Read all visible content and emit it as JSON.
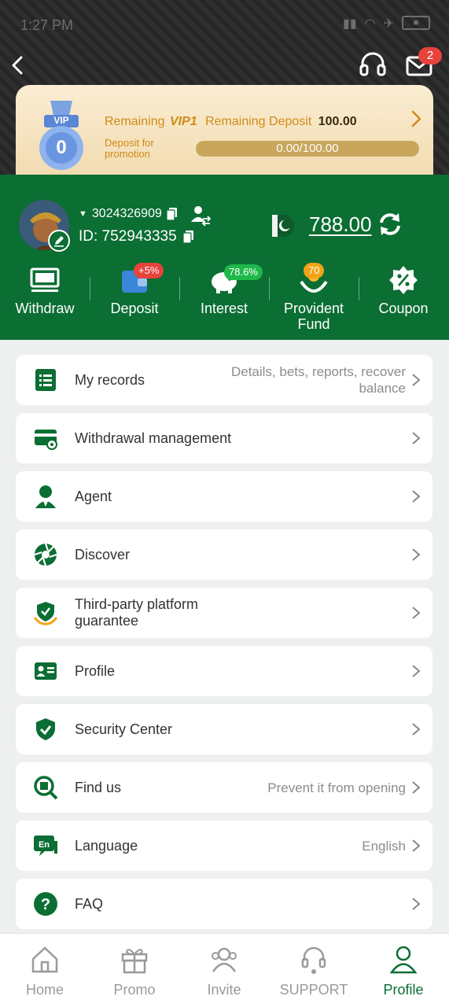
{
  "status_bar": {
    "time": "1:27 PM"
  },
  "header": {
    "mail_badge": "2"
  },
  "vip": {
    "medal_label": "VIP",
    "medal_level": "0",
    "remaining_label": "Remaining",
    "level": "VIP1",
    "remaining_deposit_label": "Remaining Deposit",
    "remaining_deposit_value": "100.00",
    "deposit_note": "Deposit for promotion",
    "progress_text": "0.00/100.00",
    "progress_fraction": 0.0
  },
  "account": {
    "phone": "3024326909",
    "id_text": "ID: 752943335",
    "balance": "788.00"
  },
  "shortcuts": [
    {
      "label": "Withdraw",
      "badge": ""
    },
    {
      "label": "Deposit",
      "badge": "+5%"
    },
    {
      "label": "Interest",
      "badge": "78.6%"
    },
    {
      "label": "Provident Fund",
      "badge": "70"
    },
    {
      "label": "Coupon",
      "badge": ""
    }
  ],
  "menu": [
    {
      "label": "My records",
      "value": "Details, bets, reports, recover balance",
      "icon": "records-icon"
    },
    {
      "label": "Withdrawal management",
      "value": "",
      "icon": "withdrawal-card-icon"
    },
    {
      "label": "Agent",
      "value": "",
      "icon": "agent-icon"
    },
    {
      "label": "Discover",
      "value": "",
      "icon": "aperture-icon"
    },
    {
      "label": "Third-party platform guarantee",
      "value": "",
      "icon": "shield-hands-icon"
    },
    {
      "label": "Profile",
      "value": "",
      "icon": "id-card-icon"
    },
    {
      "label": "Security Center",
      "value": "",
      "icon": "shield-check-icon"
    },
    {
      "label": "Find us",
      "value": "Prevent it from opening",
      "icon": "search-doc-icon"
    },
    {
      "label": "Language",
      "value": "English",
      "icon": "language-icon"
    },
    {
      "label": "FAQ",
      "value": "",
      "icon": "question-icon"
    }
  ],
  "nav": [
    {
      "label": "Home",
      "active": false
    },
    {
      "label": "Promo",
      "active": false
    },
    {
      "label": "Invite",
      "active": false
    },
    {
      "label": "SUPPORT",
      "active": false
    },
    {
      "label": "Profile",
      "active": true
    }
  ],
  "colors": {
    "brand_green": "#0b6e33",
    "gold": "#cf8b17",
    "badge_red": "#e8423c",
    "badge_green": "#1fb84a",
    "badge_orange": "#f0a316"
  }
}
